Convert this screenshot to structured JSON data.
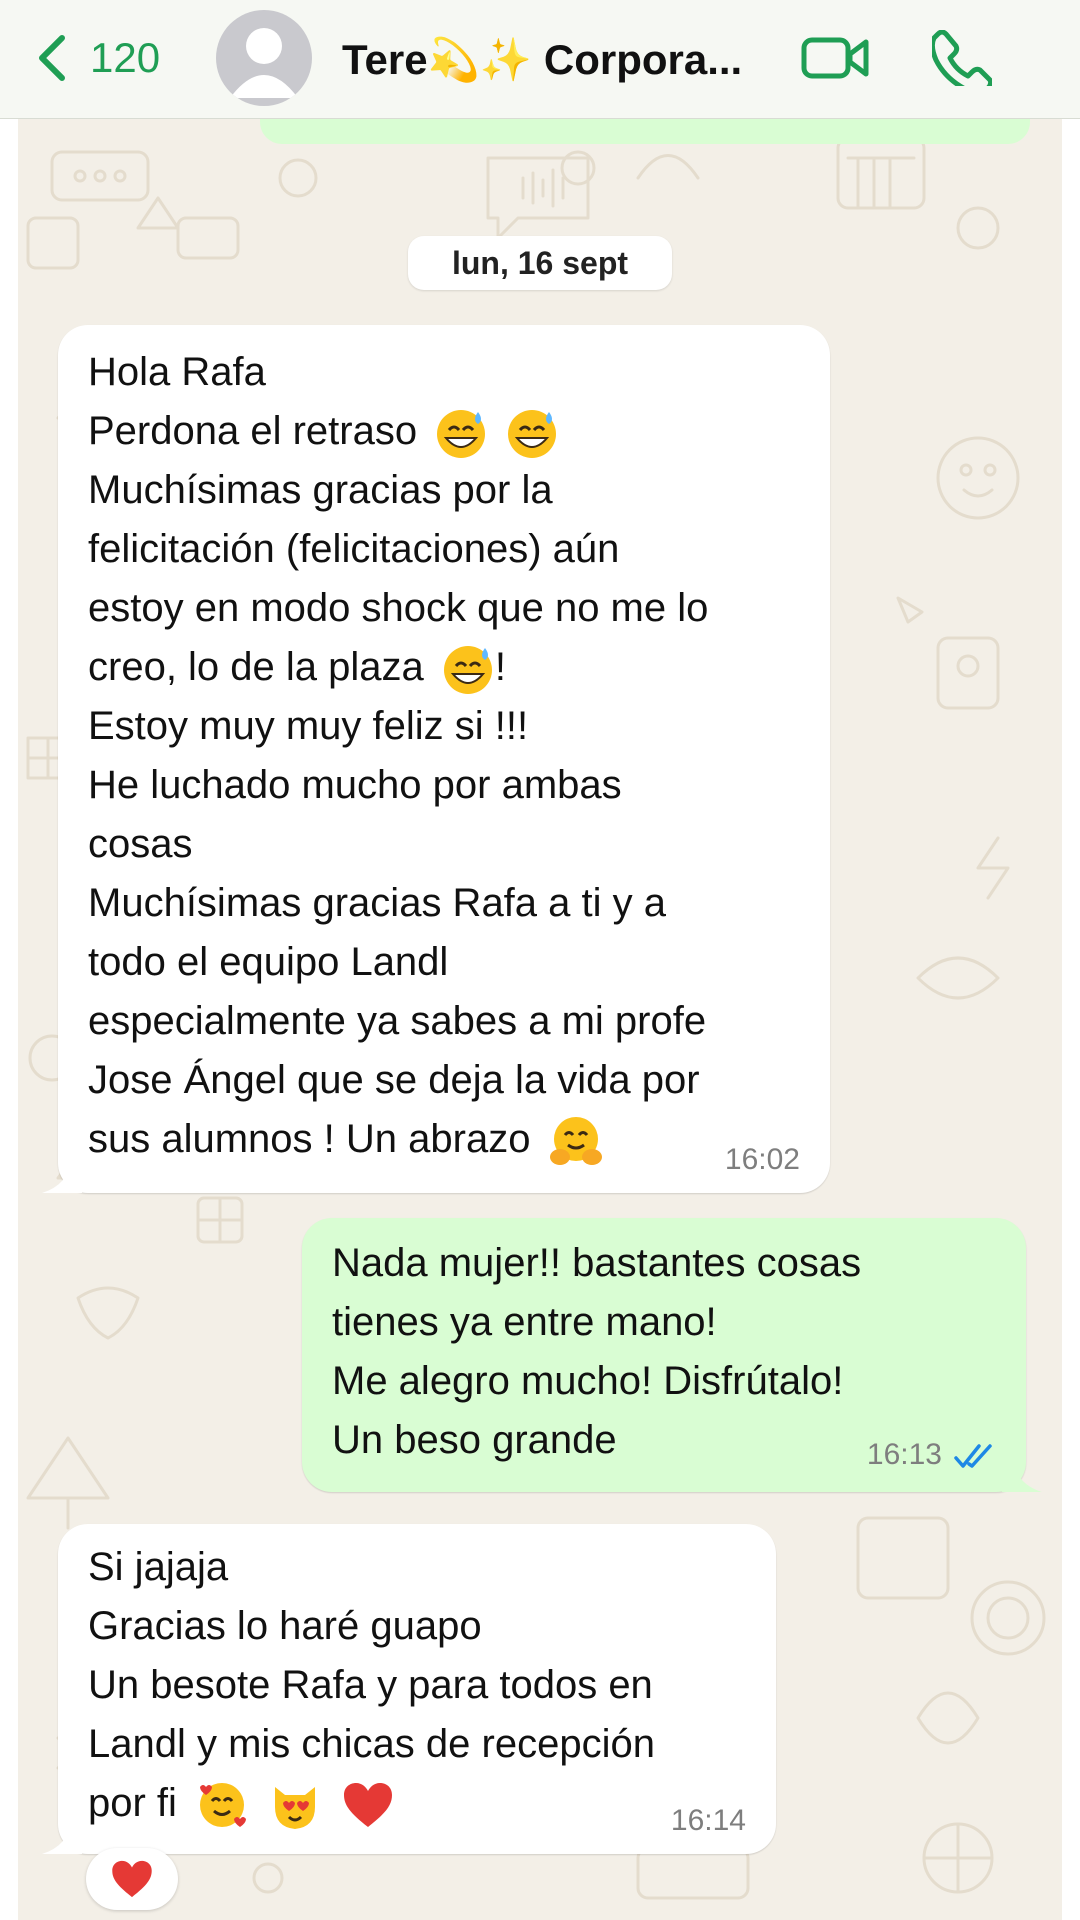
{
  "header": {
    "back_count": "120",
    "contact_name": "Tere💫✨ Corpora...",
    "icons": [
      "back-chevron-icon",
      "avatar-placeholder-icon",
      "video-call-icon",
      "phone-call-icon"
    ]
  },
  "date_separator": "lun, 16 sept",
  "messages": [
    {
      "direction": "incoming",
      "lines": [
        "Hola Rafa",
        "Perdona el retraso",
        "Muchísimas gracias por la",
        "felicitación (felicitaciones) aún",
        "estoy en modo shock que no me lo",
        "creo, lo de la plaza",
        "Estoy muy muy feliz si !!!",
        "He luchado mucho por ambas",
        "cosas",
        "Muchísimas gracias Rafa a ti y a",
        "todo el equipo Landl",
        "especialmente ya sabes a mi profe",
        "Jose Ángel que se deja la vida por",
        "sus alumnos ! Un abrazo"
      ],
      "line_suffix": "!",
      "emojis": [
        "grinning-sweat-emoji",
        "grinning-sweat-emoji",
        "grinning-sweat-emoji",
        "hugging-face-emoji"
      ],
      "time": "16:02"
    },
    {
      "direction": "outgoing",
      "lines": [
        "Nada mujer!! bastantes cosas",
        "tienes ya entre mano!",
        "Me alegro mucho! Disfrútalo!",
        "Un beso grande"
      ],
      "time": "16:13",
      "status": "read"
    },
    {
      "direction": "incoming",
      "lines": [
        "Si jajaja",
        "Gracias lo haré guapo",
        "Un besote Rafa y para todos en",
        "Landl y mis chicas de recepción",
        "por fi"
      ],
      "emojis": [
        "smiling-face-with-hearts-emoji",
        "heart-eyes-cat-emoji",
        "red-heart-emoji"
      ],
      "time": "16:14",
      "reaction": "❤️"
    }
  ],
  "colors": {
    "accent": "#1f9e54",
    "outgoing_bubble": "#d9fdd3",
    "incoming_bubble": "#ffffff",
    "wallpaper": "#f3efe7",
    "read_ticks": "#1e88e5"
  }
}
